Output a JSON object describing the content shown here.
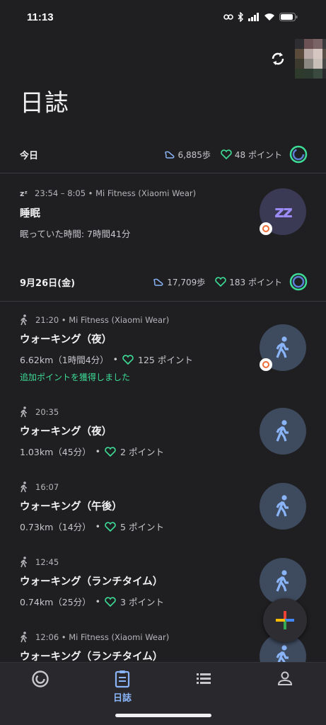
{
  "status_bar": {
    "time": "11:13"
  },
  "page_title": "日誌",
  "days": [
    {
      "label": "今日",
      "steps": "6,885歩",
      "points": "48 ポイント"
    },
    {
      "label": "9月26日(金)",
      "steps": "17,709歩",
      "points": "183 ポイント"
    }
  ],
  "entries": [
    {
      "meta": "23:54 – 8:05 • Mi Fitness (Xiaomi Wear)",
      "title": "睡眠",
      "detail": "眠っていた時間: 7時間41分",
      "type": "sleep"
    },
    {
      "meta": "21:20 • Mi Fitness (Xiaomi Wear)",
      "title": "ウォーキング（夜）",
      "distance": "6.62km（1時間4分）",
      "points": "125 ポイント",
      "extra": "追加ポイントを獲得しました",
      "type": "walk"
    },
    {
      "meta": "20:35",
      "title": "ウォーキング（夜）",
      "distance": "1.03km（45分）",
      "points": "2 ポイント",
      "type": "walk"
    },
    {
      "meta": "16:07",
      "title": "ウォーキング（午後）",
      "distance": "0.73km（14分）",
      "points": "5 ポイント",
      "type": "walk"
    },
    {
      "meta": "12:45",
      "title": "ウォーキング（ランチタイム）",
      "distance": "0.74km（25分）",
      "points": "3 ポイント",
      "type": "walk"
    },
    {
      "meta": "12:06 • Mi Fitness (Xiaomi Wear)",
      "title": "ウォーキング（ランチタイム）",
      "type": "walk"
    }
  ],
  "bottom_nav": {
    "journal_label": "日誌"
  },
  "colors": {
    "accent": "#8ab4f8",
    "points_green": "#3ddc97",
    "walk_icon": "#8ab4f8"
  },
  "icons": [
    "sync-icon",
    "zzz-icon",
    "walk-icon",
    "heart-points-icon",
    "steps-icon",
    "ring-icon",
    "add-icon",
    "list-icon",
    "profile-icon"
  ]
}
